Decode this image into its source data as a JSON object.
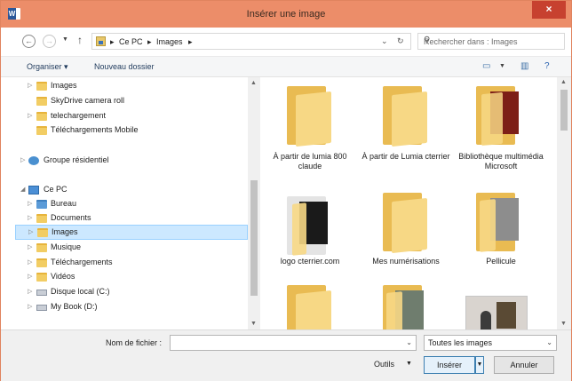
{
  "window": {
    "title": "Insérer une image",
    "app_icon": "W",
    "close": "×"
  },
  "address": {
    "crumbs": [
      "Ce PC",
      "Images"
    ],
    "search_placeholder": "Rechercher dans : Images"
  },
  "commands": {
    "organize": "Organiser ▾",
    "new_folder": "Nouveau dossier"
  },
  "tree": {
    "images_top": "Images",
    "skydrive": "SkyDrive camera roll",
    "telechargement": "telechargement",
    "telechargements_mobile": "Téléchargements Mobile",
    "groupe": "Groupe résidentiel",
    "ce_pc": "Ce PC",
    "bureau": "Bureau",
    "documents": "Documents",
    "images": "Images",
    "musique": "Musique",
    "telechargements": "Téléchargements",
    "videos": "Vidéos",
    "disque": "Disque local (C:)",
    "mybook": "My Book (D:)"
  },
  "tiles": {
    "t1": "À partir de lumia 800 claude",
    "t2": "À partir de Lumia cterrier",
    "t3": "Bibliothèque multimédia Microsoft",
    "t4": "logo cterrier.com",
    "t5": "Mes numérisations",
    "t6": "Pellicule"
  },
  "bottom": {
    "filename_label": "Nom de fichier :",
    "filename_value": "",
    "filter": "Toutes les images",
    "tools": "Outils",
    "insert": "Insérer",
    "cancel": "Annuler"
  }
}
